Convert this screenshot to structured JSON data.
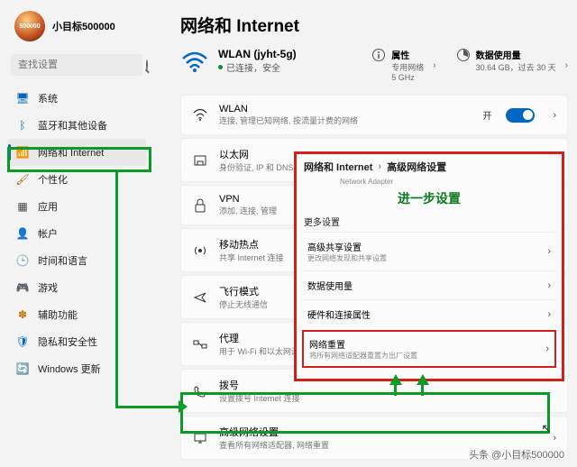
{
  "profile": {
    "name": "小目标500000",
    "sub": "",
    "avatar_text": "500000"
  },
  "search": {
    "placeholder": "查找设置"
  },
  "sidebar": {
    "items": [
      {
        "label": "系统",
        "icon": "🖥"
      },
      {
        "label": "蓝牙和其他设备",
        "icon": "ᛒ"
      },
      {
        "label": "网络和 Internet",
        "icon": "📶"
      },
      {
        "label": "个性化",
        "icon": "🖌"
      },
      {
        "label": "应用",
        "icon": "▦"
      },
      {
        "label": "帐户",
        "icon": "👤"
      },
      {
        "label": "时间和语言",
        "icon": "🕒"
      },
      {
        "label": "游戏",
        "icon": "🎮"
      },
      {
        "label": "辅助功能",
        "icon": "✽"
      },
      {
        "label": "隐私和安全性",
        "icon": "🛡"
      },
      {
        "label": "Windows 更新",
        "icon": "🔄"
      }
    ]
  },
  "page": {
    "title": "网络和 Internet",
    "wifi": {
      "name": "WLAN (jyht-5g)",
      "status": "已连接，安全"
    },
    "props": {
      "p1_title": "属性",
      "p1_sub": "专用网络\n5 GHz",
      "p2_title": "数据使用量",
      "p2_sub": "30.64 GB，过去 30 天"
    },
    "cards": {
      "wlan": {
        "title": "WLAN",
        "sub": "连接, 管理已知网络, 按流量计费的网络",
        "on": "开"
      },
      "eth": {
        "title": "以太网",
        "sub": "身份验证, IP 和 DNS 设置"
      },
      "vpn": {
        "title": "VPN",
        "sub": "添加, 连接, 管理"
      },
      "hot": {
        "title": "移动热点",
        "sub": "共享 Internet 连接"
      },
      "air": {
        "title": "飞行模式",
        "sub": "停止无线通信"
      },
      "proxy": {
        "title": "代理",
        "sub": "用于 Wi-Fi 和以太网连接"
      },
      "dial": {
        "title": "拨号",
        "sub": "设置拨号 Internet 连接"
      },
      "adv": {
        "title": "高级网络设置",
        "sub": "查看所有网络适配器, 网络重置"
      }
    }
  },
  "overlay": {
    "bc1": "网络和 Internet",
    "bc2": "高级网络设置",
    "small": "Network Adapter",
    "anno": "进一步设置",
    "section": "更多设置",
    "items": {
      "share": {
        "title": "高级共享设置",
        "sub": "更改网络发现和共享设置"
      },
      "data": {
        "title": "数据使用量"
      },
      "hw": {
        "title": "硬件和连接属性"
      },
      "reset": {
        "title": "网络重置",
        "sub": "将所有网络适配器重置为出厂设置"
      }
    }
  },
  "watermark": "头条 @小目标500000"
}
